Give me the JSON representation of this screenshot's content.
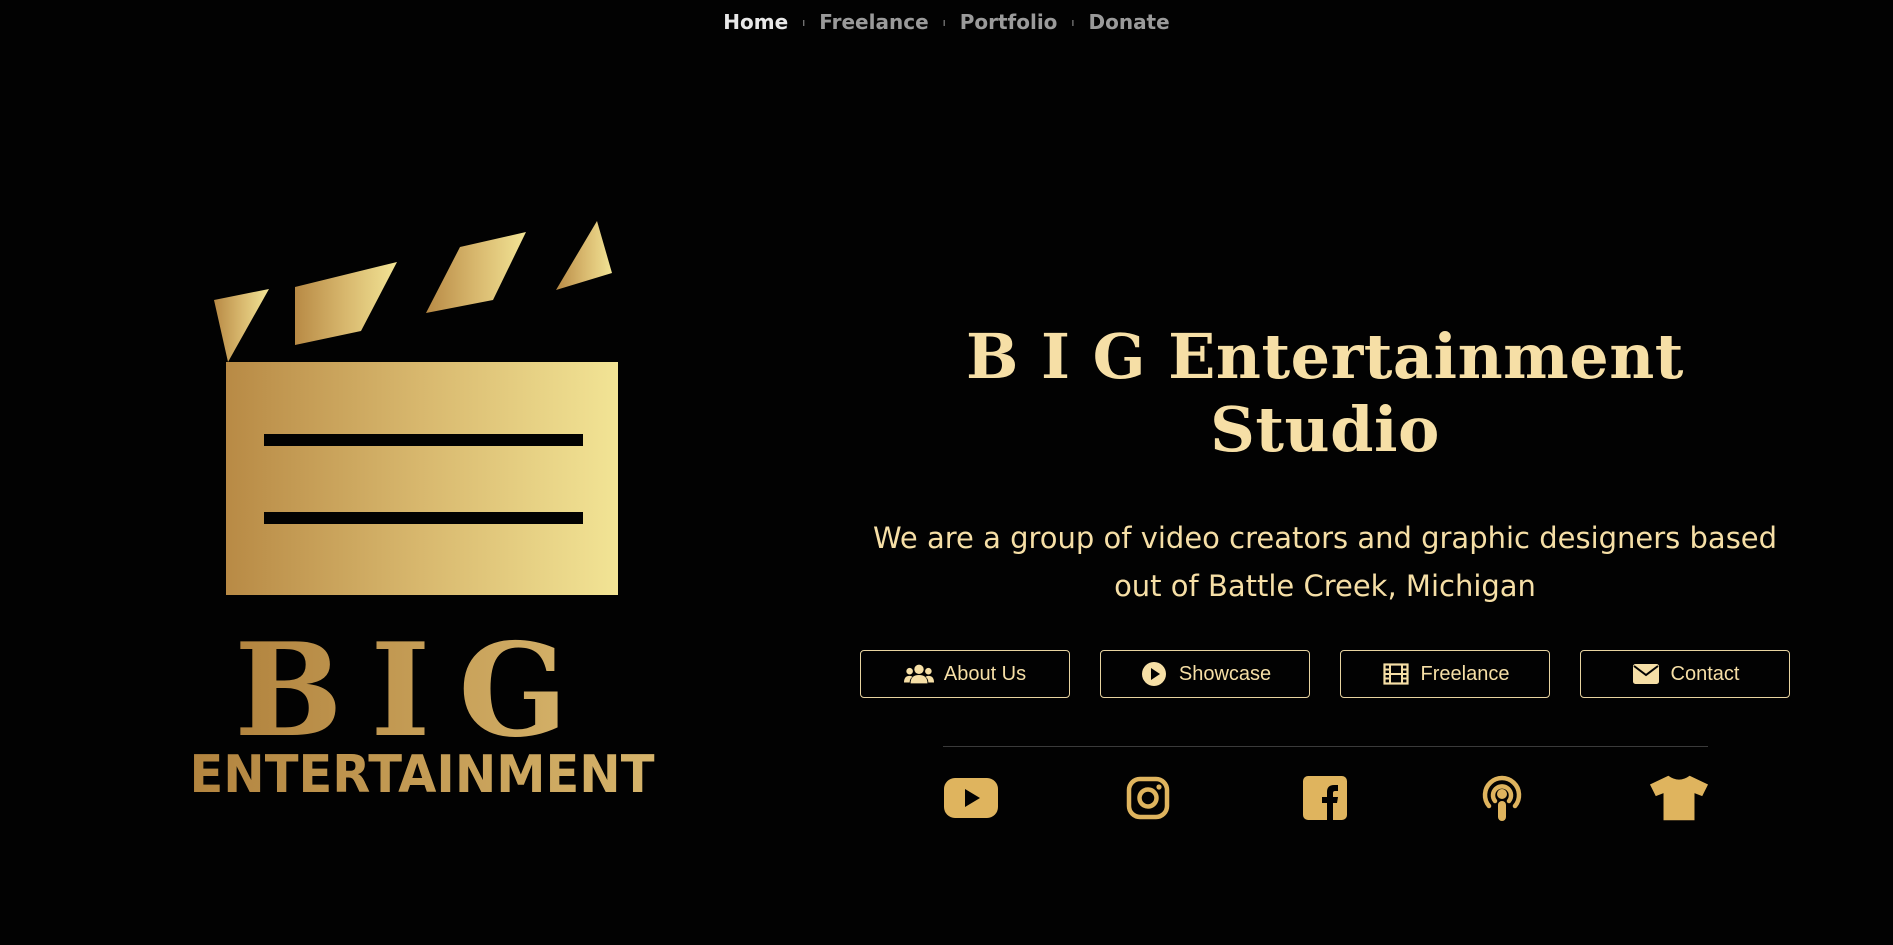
{
  "nav": {
    "items": [
      {
        "label": "Home",
        "active": true
      },
      {
        "label": "Freelance",
        "active": false
      },
      {
        "label": "Portfolio",
        "active": false
      },
      {
        "label": "Donate",
        "active": false
      }
    ],
    "separator": "ı"
  },
  "logo": {
    "text_main": "BIG",
    "text_sub": "ENTERTAINMENT",
    "icon": "clapperboard-icon"
  },
  "hero": {
    "title": "B I G Entertainment Studio",
    "subtitle": "We are a group of video creators and graphic designers based out of Battle Creek, Michigan"
  },
  "buttons": [
    {
      "label": "About Us",
      "icon": "users-icon"
    },
    {
      "label": "Showcase",
      "icon": "play-circle-icon"
    },
    {
      "label": "Freelance",
      "icon": "film-icon"
    },
    {
      "label": "Contact",
      "icon": "envelope-icon"
    }
  ],
  "socials": [
    {
      "icon": "youtube-icon"
    },
    {
      "icon": "instagram-icon"
    },
    {
      "icon": "facebook-icon"
    },
    {
      "icon": "podcast-icon"
    },
    {
      "icon": "tshirt-icon"
    }
  ],
  "colors": {
    "background": "#020202",
    "gold": "#c9a45a",
    "cream": "#f6dfa6",
    "nav_text": "#9a9a9a"
  }
}
